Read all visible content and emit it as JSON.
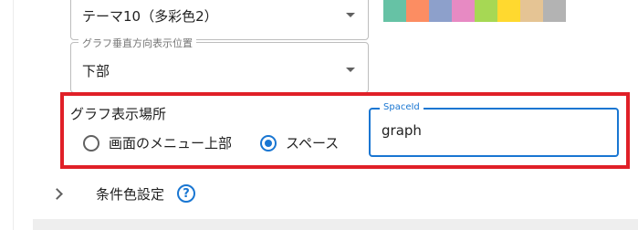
{
  "theme_select": {
    "value": "テーマ10（多彩色2）"
  },
  "palette": [
    "#66c2a5",
    "#fc8d62",
    "#8da0cb",
    "#e78ac3",
    "#a6d854",
    "#ffd92f",
    "#e5c494",
    "#b3b3b3"
  ],
  "graph_position": {
    "label": "グラフ垂直方向表示位置",
    "value": "下部"
  },
  "graph_location": {
    "label": "グラフ表示場所",
    "options": [
      {
        "label": "画面のメニュー上部",
        "checked": false
      },
      {
        "label": "スペース",
        "checked": true
      }
    ]
  },
  "space_id": {
    "label": "SpaceId",
    "value": "graph"
  },
  "conditional_color": {
    "label": "条件色設定",
    "help_icon": "?"
  },
  "colors": {
    "accent": "#1976d2",
    "highlight": "#e02028"
  }
}
